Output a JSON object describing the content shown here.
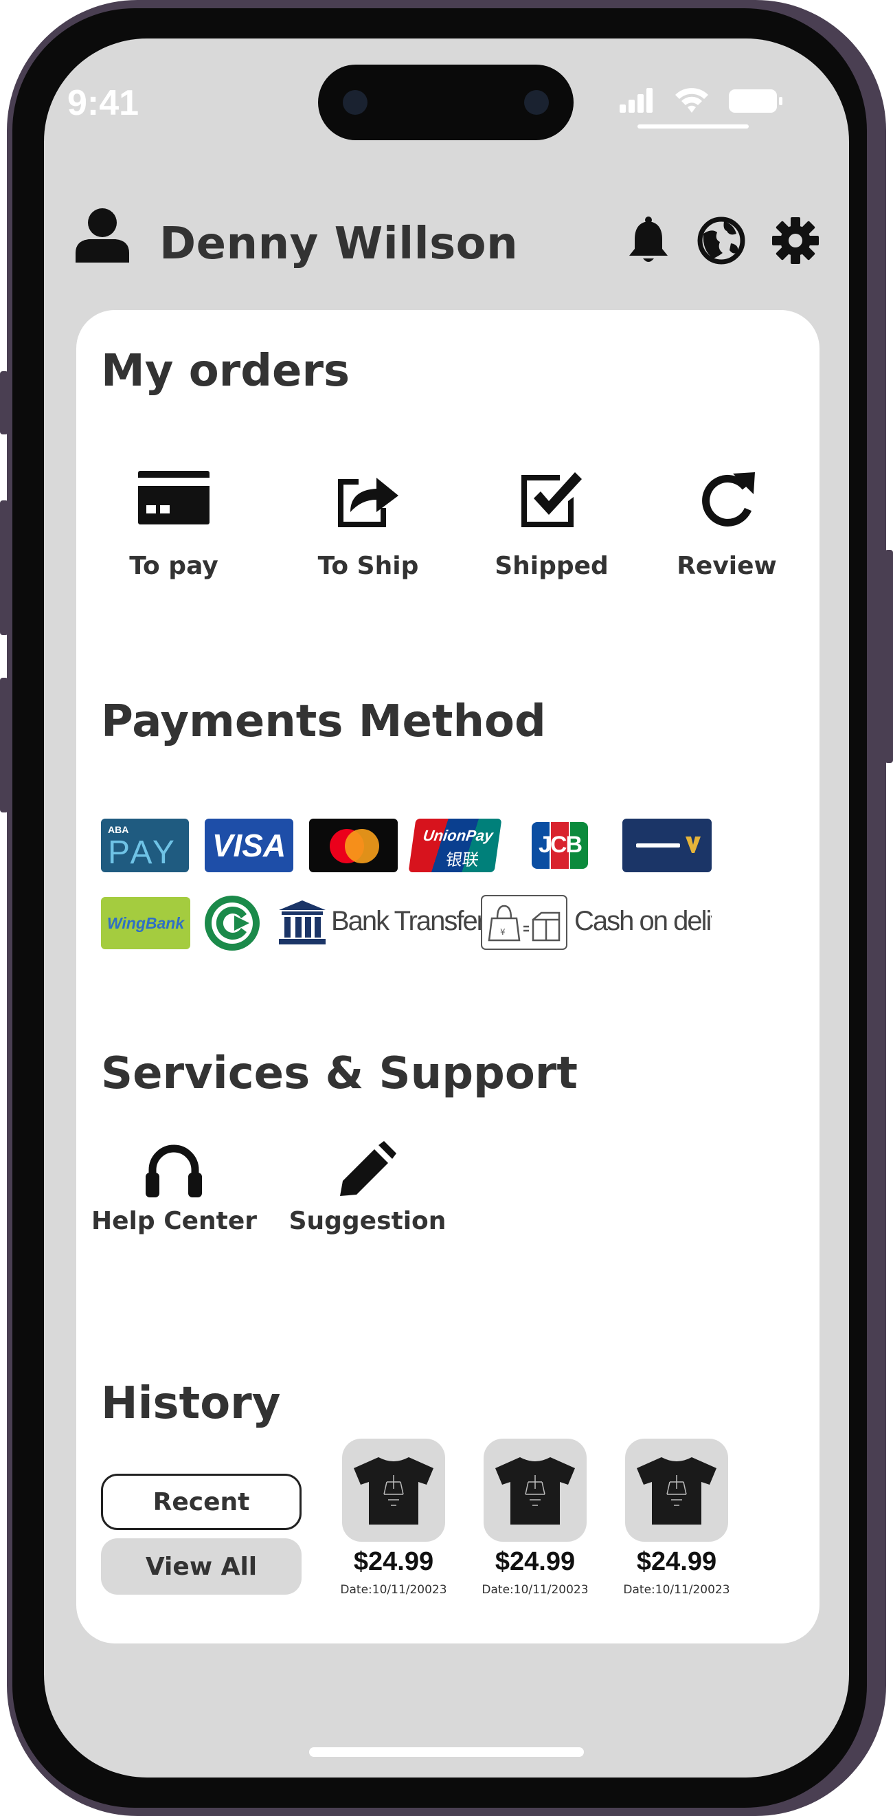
{
  "status_bar": {
    "time": "9:41"
  },
  "header": {
    "user_name": "Denny Willson",
    "icons": [
      "person-icon",
      "bell-icon",
      "globe-icon",
      "gear-icon"
    ]
  },
  "orders": {
    "title": "My orders",
    "items": [
      {
        "label": "To pay",
        "icon": "credit-card-icon"
      },
      {
        "label": "To Ship",
        "icon": "share-box-icon"
      },
      {
        "label": "Shipped",
        "icon": "check-square-icon"
      },
      {
        "label": "Review",
        "icon": "refresh-icon"
      }
    ]
  },
  "payments": {
    "title": "Payments Method",
    "logos": {
      "aba_small": "ABA",
      "aba_big": "PAY",
      "visa": "VISA",
      "unionpay": "UnionPay",
      "unionpay_cn": "银联",
      "jcb": "JCB",
      "wing": "WingBank",
      "bank_transfer": "Bank Transfer",
      "cash_on_delivery": "Cash on delivery"
    }
  },
  "services": {
    "title": "Services & Support",
    "items": [
      {
        "label": "Help Center",
        "icon": "headphones-icon"
      },
      {
        "label": "Suggestion",
        "icon": "pencil-icon"
      }
    ]
  },
  "history": {
    "title": "History",
    "recent_label": "Recent",
    "view_all_label": "View All",
    "items": [
      {
        "price": "$24.99",
        "date": "Date:10/11/20023",
        "icon": "tshirt-icon"
      },
      {
        "price": "$24.99",
        "date": "Date:10/11/20023",
        "icon": "tshirt-icon"
      },
      {
        "price": "$24.99",
        "date": "Date:10/11/20023",
        "icon": "tshirt-icon"
      }
    ]
  },
  "colors": {
    "screen_bg": "#d9d9d9",
    "card_bg": "#ffffff",
    "text": "#333333",
    "frame": "#4a3f52",
    "aba": "#1f5b80",
    "visa": "#1e4ea8",
    "wing": "#a4cc3f",
    "bank_navy": "#1b3567"
  }
}
